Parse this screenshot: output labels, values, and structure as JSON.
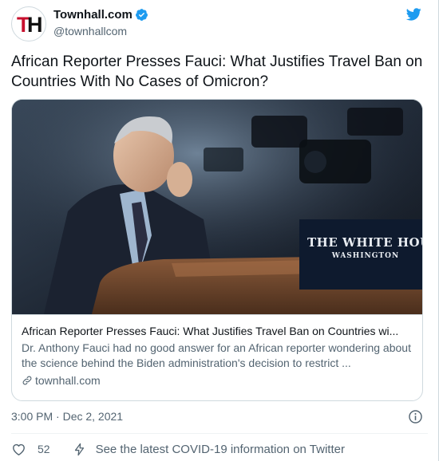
{
  "account": {
    "display_name": "Townhall.com",
    "handle": "@townhallcom",
    "avatar_letters": {
      "t": "T",
      "h": "H"
    }
  },
  "tweet": {
    "text": "African Reporter Presses Fauci: What Justifies Travel Ban on Countries With No Cases of Omicron?"
  },
  "card": {
    "image_sign": {
      "line1": "THE WHITE HOUSE",
      "line2": "WASHINGTON"
    },
    "title": "African Reporter Presses Fauci: What Justifies Travel Ban on Countries wi...",
    "description": "Dr. Anthony Fauci had no good answer for an African reporter wondering about the science behind the Biden administration's decision to restrict ...",
    "domain": "townhall.com"
  },
  "meta": {
    "timestamp": "3:00 PM · Dec 2, 2021"
  },
  "actions": {
    "like_count": "52",
    "covid_info": "See the latest COVID-19 information on Twitter"
  },
  "colors": {
    "twitter_blue": "#1d9bf0",
    "secondary_text": "#536471",
    "border": "#cfd9de",
    "brand_red": "#c8102e"
  }
}
